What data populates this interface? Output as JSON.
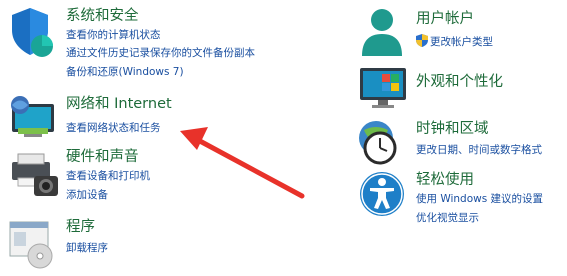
{
  "left": {
    "system_security": {
      "title": "系统和安全",
      "links": [
        "查看你的计算机状态",
        "通过文件历史记录保存你的文件备份副本",
        "备份和还原(Windows 7)"
      ]
    },
    "network": {
      "title": "网络和 Internet",
      "links": [
        "查看网络状态和任务"
      ]
    },
    "hardware": {
      "title": "硬件和声音",
      "links": [
        "查看设备和打印机",
        "添加设备"
      ]
    },
    "programs": {
      "title": "程序",
      "links": [
        "卸载程序"
      ]
    }
  },
  "right": {
    "user_accounts": {
      "title": "用户帐户",
      "links": [
        "更改帐户类型"
      ]
    },
    "appearance": {
      "title": "外观和个性化"
    },
    "clock_region": {
      "title": "时钟和区域",
      "links": [
        "更改日期、时间或数字格式"
      ]
    },
    "ease_access": {
      "title": "轻松使用",
      "links": [
        "使用 Windows 建议的设置",
        "优化视觉显示"
      ]
    }
  },
  "colors": {
    "title_green": "#1e6b3a",
    "link_blue": "#1a4fa0",
    "annotation_red": "#e8322a",
    "icon_teal": "#1a8a8a"
  }
}
